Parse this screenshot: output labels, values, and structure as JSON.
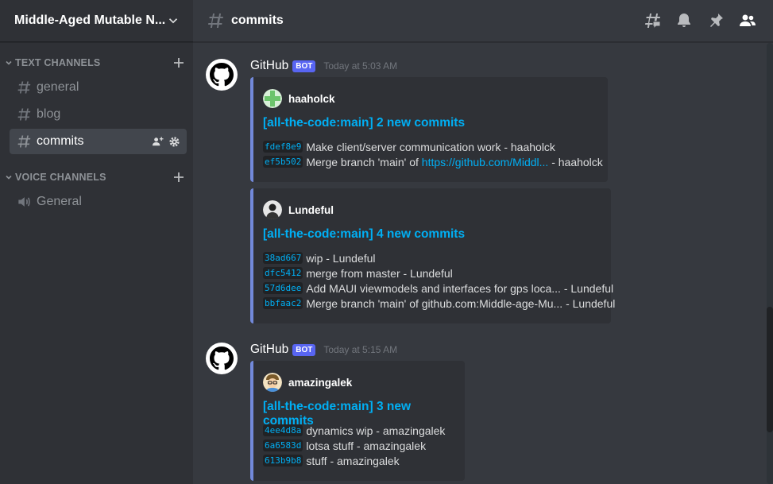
{
  "server": {
    "name": "Middle-Aged Mutable N..."
  },
  "categories": [
    {
      "label": "TEXT CHANNELS",
      "channels": [
        "general",
        "blog",
        "commits"
      ],
      "active": "commits"
    },
    {
      "label": "VOICE CHANNELS",
      "channels": [
        "General"
      ]
    }
  ],
  "topbar": {
    "channel": "commits"
  },
  "messages": [
    {
      "author": "GitHub",
      "badge": "BOT",
      "timestamp": "Today at 5:03 AM",
      "embeds": [
        {
          "author": "haaholck",
          "title": "[all-the-code:main] 2 new commits",
          "commits": [
            {
              "hash": "fdef8e9",
              "text": "Make client/server communication work - haaholck"
            },
            {
              "hash": "ef5b502",
              "pre": "Merge branch 'main' of ",
              "link": "https://github.com/Middl...",
              "post": " - haaholck"
            }
          ]
        },
        {
          "author": "Lundeful",
          "title": "[all-the-code:main] 4 new commits",
          "commits": [
            {
              "hash": "38ad667",
              "text": "wip - Lundeful"
            },
            {
              "hash": "dfc5412",
              "text": "merge from master - Lundeful"
            },
            {
              "hash": "57d6dee",
              "text": "Add MAUI viewmodels and interfaces for gps loca... - Lundeful"
            },
            {
              "hash": "bbfaac2",
              "text": "Merge branch 'main' of github.com:Middle-age-Mu... - Lundeful"
            }
          ]
        }
      ]
    },
    {
      "author": "GitHub",
      "badge": "BOT",
      "timestamp": "Today at 5:15 AM",
      "embeds": [
        {
          "author": "amazingalek",
          "title": "[all-the-code:main] 3 new commits",
          "commits": [
            {
              "hash": "4ee4d8a",
              "text": "dynamics wip - amazingalek"
            },
            {
              "hash": "6a6583d",
              "text": "lotsa stuff - amazingalek"
            },
            {
              "hash": "613b9b8",
              "text": "stuff - amazingalek"
            }
          ]
        }
      ]
    }
  ],
  "colors": {
    "background": "#36393f",
    "sidebar": "#2f3136",
    "embed_border": "#7289da",
    "link": "#00aff4",
    "bot_badge": "#5865f2"
  },
  "icons": {
    "server_menu": "chevron-down-icon",
    "channel": "hash-icon",
    "voice": "speaker-icon",
    "threads": "threads-icon",
    "notifications": "bell-icon",
    "pins": "pin-icon",
    "members": "members-icon",
    "bot_avatar": "github-icon"
  }
}
